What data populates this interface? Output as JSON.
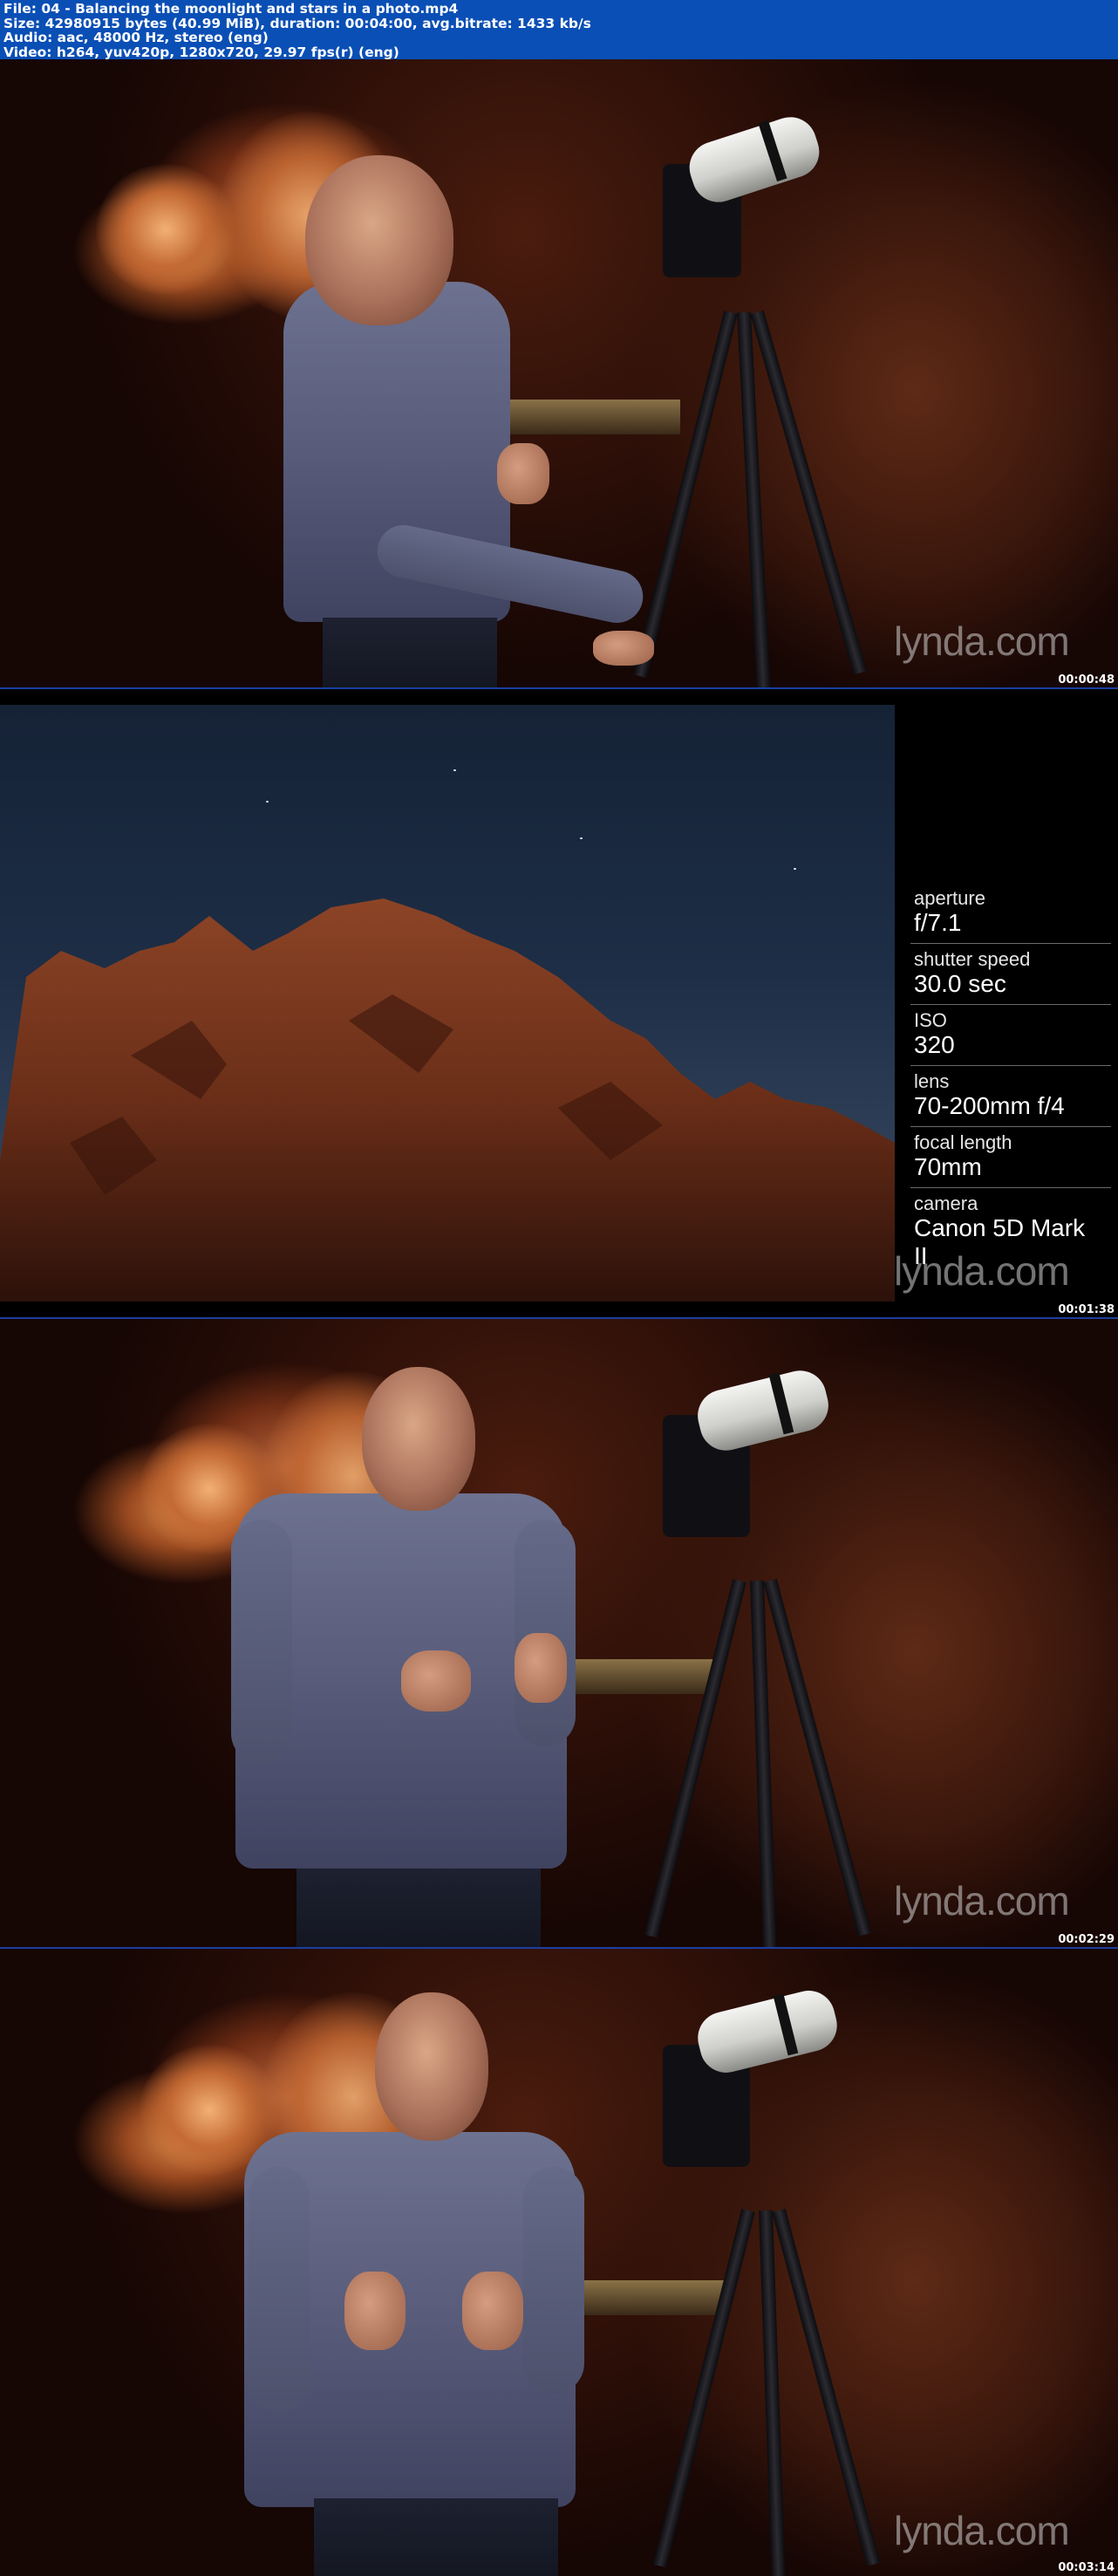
{
  "header": {
    "file_line": "File: 04 - Balancing the moonlight and stars in a photo.mp4",
    "size_line": "Size: 42980915 bytes (40.99 MiB), duration: 00:04:00, avg.bitrate: 1433 kb/s",
    "audio_line": "Audio: aac, 48000 Hz, stereo (eng)",
    "video_line": "Video: h264, yuv420p, 1280x720, 29.97 fps(r) (eng)",
    "background": "#0a4fb5"
  },
  "frames": [
    {
      "timestamp": "00:00:48",
      "watermark": "lynda.com",
      "scene": "presenter adjusting tripod in canyon"
    },
    {
      "timestamp": "00:01:38",
      "watermark": "lynda.com",
      "scene": "red rock formation under night sky"
    },
    {
      "timestamp": "00:02:29",
      "watermark": "lynda.com",
      "scene": "presenter talking to camera"
    },
    {
      "timestamp": "00:03:14",
      "watermark": "lynda.com",
      "scene": "presenter gesturing while talking"
    }
  ],
  "exif_panel": {
    "items": [
      {
        "label": "aperture",
        "value": "f/7.1"
      },
      {
        "label": "shutter speed",
        "value": "30.0 sec"
      },
      {
        "label": "ISO",
        "value": "320"
      },
      {
        "label": "lens",
        "value": "70-200mm f/4"
      },
      {
        "label": "focal length",
        "value": "70mm"
      },
      {
        "label": "camera",
        "value": "Canon 5D Mark II"
      }
    ]
  },
  "colors": {
    "frame_separator": "#1b3fa0",
    "canyon_light": "#f2b074",
    "night_sky": "#1d2e46",
    "shirt": "#5d6280"
  }
}
